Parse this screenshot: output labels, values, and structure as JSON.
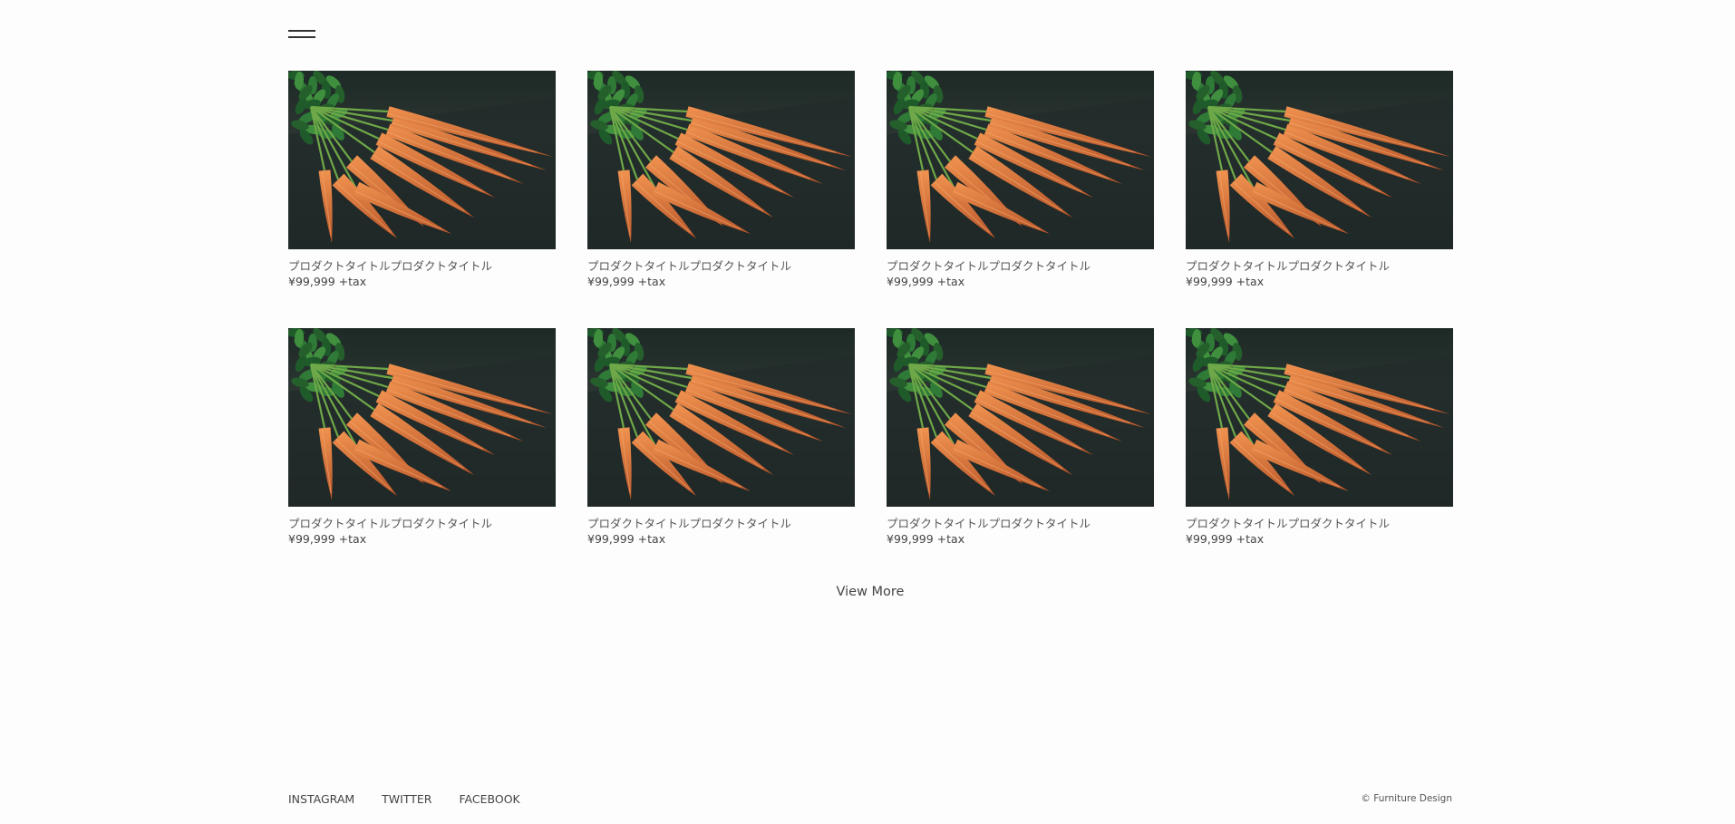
{
  "header": {
    "menu_icon": "hamburger-icon"
  },
  "products": [
    {
      "title": "プロダクトタイトルプロダクトタイトル",
      "price": "¥99,999 +tax",
      "image": "carrots-photo"
    },
    {
      "title": "プロダクトタイトルプロダクトタイトル",
      "price": "¥99,999 +tax",
      "image": "carrots-photo"
    },
    {
      "title": "プロダクトタイトルプロダクトタイトル",
      "price": "¥99,999 +tax",
      "image": "carrots-photo"
    },
    {
      "title": "プロダクトタイトルプロダクトタイトル",
      "price": "¥99,999 +tax",
      "image": "carrots-photo"
    },
    {
      "title": "プロダクトタイトルプロダクトタイトル",
      "price": "¥99,999 +tax",
      "image": "carrots-photo"
    },
    {
      "title": "プロダクトタイトルプロダクトタイトル",
      "price": "¥99,999 +tax",
      "image": "carrots-photo"
    },
    {
      "title": "プロダクトタイトルプロダクトタイトル",
      "price": "¥99,999 +tax",
      "image": "carrots-photo"
    },
    {
      "title": "プロダクトタイトルプロダクトタイトル",
      "price": "¥99,999 +tax",
      "image": "carrots-photo"
    }
  ],
  "view_more": {
    "label": "View More"
  },
  "footer": {
    "links": [
      "INSTAGRAM",
      "TWITTER",
      "FACEBOOK"
    ],
    "copyright": "© Furniture Design"
  },
  "colors": {
    "background": "#fefdfd",
    "text": "#444444",
    "photo_dark": "#1c2624",
    "carrot": "#e07a3c"
  }
}
